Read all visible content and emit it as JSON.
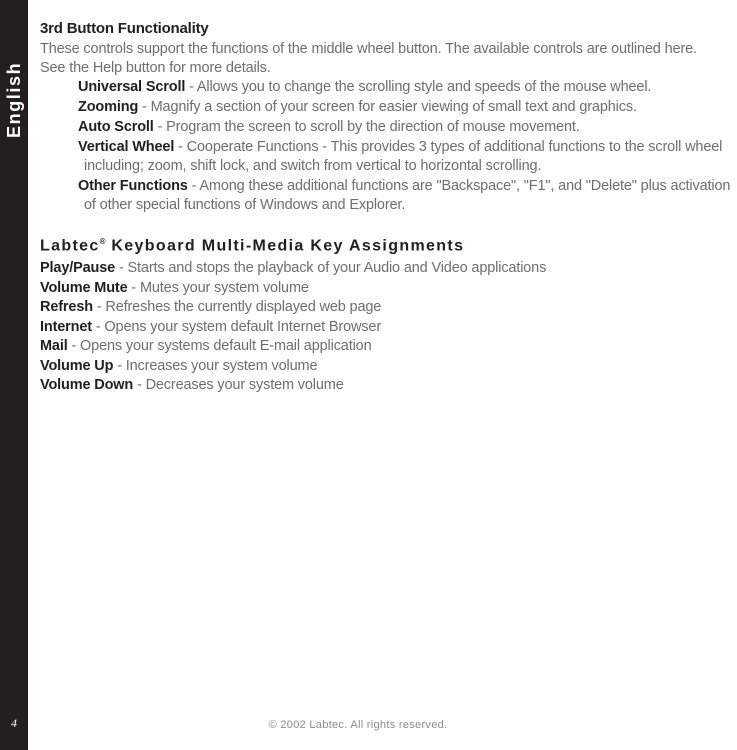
{
  "sidebar": {
    "language_label": "English",
    "page_number": "4"
  },
  "main": {
    "section": {
      "heading": "3rd Button Functionality",
      "intro": "These controls support the functions of the middle wheel button. The available controls are outlined here. See the Help button for more details.",
      "features": [
        {
          "term": "Universal Scroll",
          "description": " - Allows you to change the scrolling style and speeds of the mouse wheel."
        },
        {
          "term": "Zooming",
          "description": " - Magnify a section of your screen for easier viewing of small text and graphics."
        },
        {
          "term": "Auto Scroll",
          "description": " - Program the screen to scroll by the direction of mouse movement."
        },
        {
          "term": "Vertical Wheel",
          "description": " - Cooperate Functions - This provides 3 types of additional functions to the scroll wheel including; zoom, shift lock, and switch from vertical to horizontal scrolling."
        },
        {
          "term": "Other Functions",
          "description": " - Among these additional functions are \"Backspace\", \"F1\", and \"Delete\" plus activation of other special functions of Windows and Explorer."
        }
      ]
    },
    "media_section": {
      "heading_brand": "Labtec",
      "heading_registered": "®",
      "heading_rest": " Keyboard Multi-Media Key Assignments",
      "keys": [
        {
          "term": "Play/Pause",
          "description": " - Starts and stops the playback of your Audio and Video applications"
        },
        {
          "term": "Volume Mute",
          "description": " - Mutes your system volume"
        },
        {
          "term": "Refresh",
          "description": " - Refreshes the currently displayed web page"
        },
        {
          "term": "Internet",
          "description": " - Opens your system default Internet Browser"
        },
        {
          "term": "Mail",
          "description": " - Opens your systems default E-mail application"
        },
        {
          "term": "Volume Up",
          "description": " - Increases your system volume"
        },
        {
          "term": "Volume Down",
          "description": " - Decreases your system volume"
        }
      ]
    }
  },
  "footer": {
    "copyright": "© 2002 Labtec.  All rights reserved."
  },
  "colors": {
    "sidebar_background": "#231f20",
    "body_text": "#6d6e71",
    "heading_text": "#231f20",
    "page_background": "#ffffff"
  }
}
